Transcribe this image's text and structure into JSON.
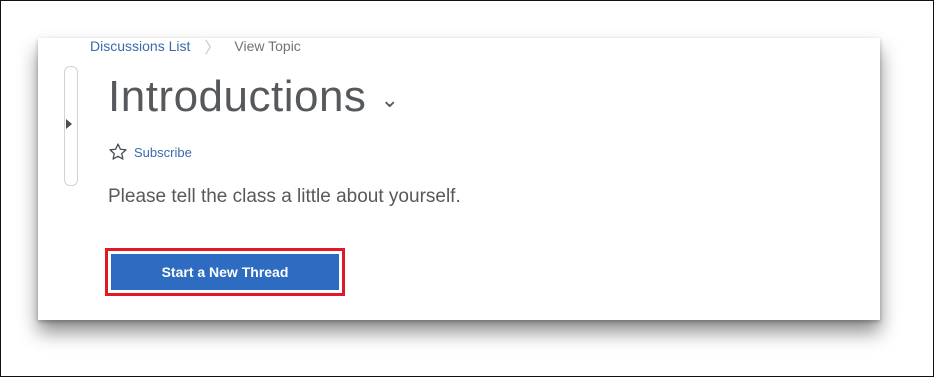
{
  "breadcrumb": {
    "items": [
      "Discussions List",
      "View Topic"
    ]
  },
  "topic": {
    "title": "Introductions",
    "subscribe_label": "Subscribe",
    "description": "Please tell the class a little about yourself."
  },
  "actions": {
    "start_thread_label": "Start a New Thread"
  },
  "colors": {
    "link": "#3a6aa8",
    "primary_button": "#2d6cc0",
    "highlight_outline": "#e0192a"
  },
  "icons": {
    "subscribe": "star-outline-icon",
    "title_menu": "chevron-down-icon",
    "side_toggle": "caret-right-icon",
    "breadcrumb_separator": "chevron-right-icon"
  }
}
